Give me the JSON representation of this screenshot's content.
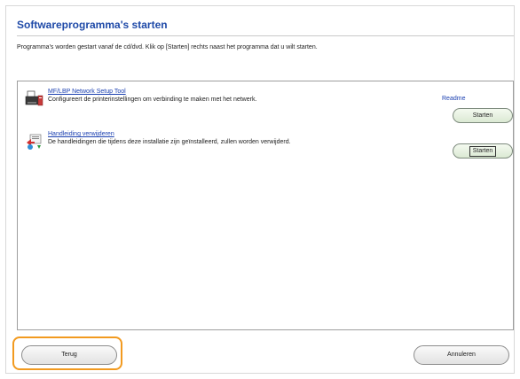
{
  "window": {
    "title": "Softwareprogramma's starten",
    "description": "Programma's worden gestart vanaf de cd/dvd. Klik op [Starten] rechts naast het programma dat u wilt starten."
  },
  "programs": [
    {
      "name": "MF/LBP Network Setup Tool",
      "description": "Configureert de printerinstellingen om verbinding te maken met het netwerk.",
      "readme_label": "Readme",
      "start_label": "Starten",
      "icon": "network-setup-tool-icon"
    },
    {
      "name": "Handleiding verwijderen",
      "description": "De handleidingen die tijdens deze installatie zijn geïnstalleerd, zullen worden verwijderd.",
      "start_label": "Starten",
      "icon": "uninstall-manual-icon"
    }
  ],
  "footer": {
    "back_label": "Terug",
    "cancel_label": "Annuleren"
  },
  "colors": {
    "title": "#1f4aa8",
    "link": "#1a3fb0",
    "focus_outline": "#f29a1f",
    "start_button": "#dbe9d3"
  }
}
